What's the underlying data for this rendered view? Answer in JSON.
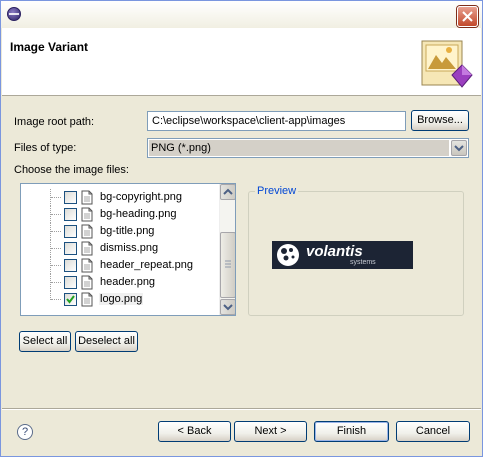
{
  "window": {
    "title": "Image Variant"
  },
  "form": {
    "root_path_label": "Image root path:",
    "root_path_value": "C:\\eclipse\\workspace\\client-app\\images",
    "browse_label": "Browse...",
    "file_type_label": "Files of type:",
    "file_type_value": "PNG (*.png)",
    "choose_label": "Choose the image files:"
  },
  "files": [
    {
      "name": "bg-copyright.png",
      "checked": false
    },
    {
      "name": "bg-heading.png",
      "checked": false
    },
    {
      "name": "bg-title.png",
      "checked": false
    },
    {
      "name": "dismiss.png",
      "checked": false
    },
    {
      "name": "header_repeat.png",
      "checked": false
    },
    {
      "name": "header.png",
      "checked": false
    },
    {
      "name": "logo.png",
      "checked": true
    }
  ],
  "preview": {
    "label": "Preview",
    "logo_text": "volantis",
    "logo_subtext": "systems"
  },
  "buttons": {
    "select_all": "Select all",
    "deselect_all": "Deselect all",
    "back": "< Back",
    "next": "Next >",
    "finish": "Finish",
    "cancel": "Cancel"
  },
  "colors": {
    "dialog_bg": "#ece9d8",
    "check_green": "#21a121",
    "preview_label": "#0046d5",
    "close_red": "#c2482a"
  }
}
